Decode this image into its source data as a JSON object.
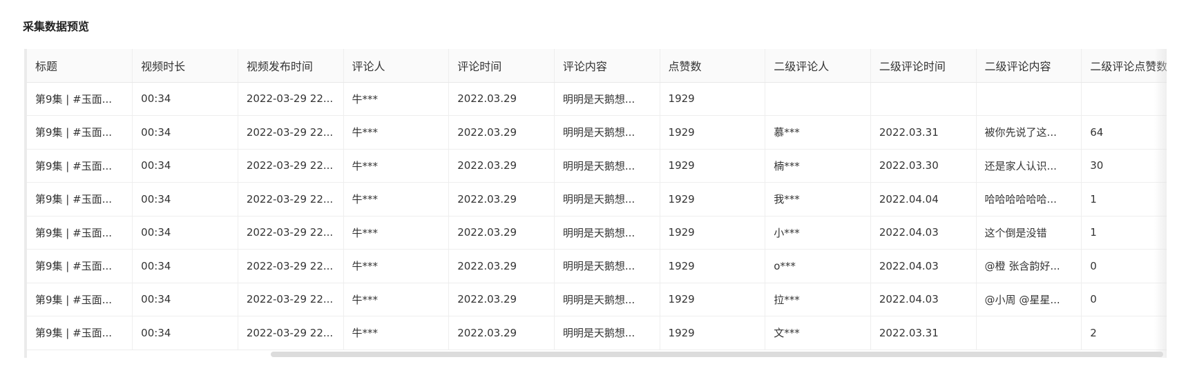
{
  "section": {
    "title": "采集数据预览"
  },
  "table": {
    "columns": [
      "标题",
      "视频时长",
      "视频发布时间",
      "评论人",
      "评论时间",
      "评论内容",
      "点赞数",
      "二级评论人",
      "二级评论时间",
      "二级评论内容",
      "二级评论点赞数"
    ],
    "rows": [
      [
        "第9集 | #玉面...",
        "00:34",
        "2022-03-29 22...",
        "牛***",
        "2022.03.29",
        "明明是天鹅想...",
        "1929",
        "",
        "",
        "",
        ""
      ],
      [
        "第9集 | #玉面...",
        "00:34",
        "2022-03-29 22...",
        "牛***",
        "2022.03.29",
        "明明是天鹅想...",
        "1929",
        "慕***",
        "2022.03.31",
        "被你先说了这...",
        "64"
      ],
      [
        "第9集 | #玉面...",
        "00:34",
        "2022-03-29 22...",
        "牛***",
        "2022.03.29",
        "明明是天鹅想...",
        "1929",
        "楠***",
        "2022.03.30",
        "还是家人认识...",
        "30"
      ],
      [
        "第9集 | #玉面...",
        "00:34",
        "2022-03-29 22...",
        "牛***",
        "2022.03.29",
        "明明是天鹅想...",
        "1929",
        "我***",
        "2022.04.04",
        "哈哈哈哈哈哈...",
        "1"
      ],
      [
        "第9集 | #玉面...",
        "00:34",
        "2022-03-29 22...",
        "牛***",
        "2022.03.29",
        "明明是天鹅想...",
        "1929",
        "小***",
        "2022.04.03",
        "这个倒是没错",
        "1"
      ],
      [
        "第9集 | #玉面...",
        "00:34",
        "2022-03-29 22...",
        "牛***",
        "2022.03.29",
        "明明是天鹅想...",
        "1929",
        "o***",
        "2022.04.03",
        "@橙 张含韵好...",
        "0"
      ],
      [
        "第9集 | #玉面...",
        "00:34",
        "2022-03-29 22...",
        "牛***",
        "2022.03.29",
        "明明是天鹅想...",
        "1929",
        "拉***",
        "2022.04.03",
        "@小周 @星星...",
        "0"
      ],
      [
        "第9集 | #玉面...",
        "00:34",
        "2022-03-29 22...",
        "牛***",
        "2022.03.29",
        "明明是天鹅想...",
        "1929",
        "文***",
        "2022.03.31",
        "",
        "2"
      ]
    ]
  }
}
